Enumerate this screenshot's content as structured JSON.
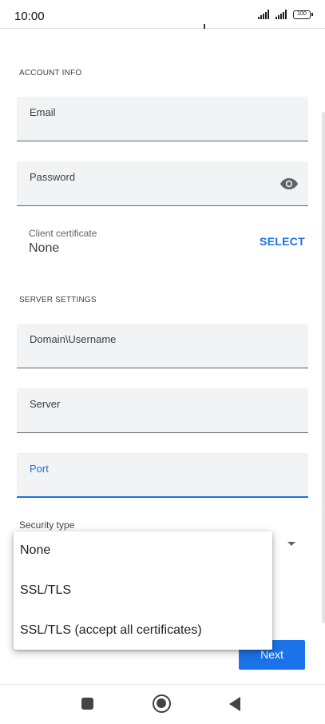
{
  "status_bar": {
    "time": "10:00",
    "battery": "100"
  },
  "account_info": {
    "section_label": "ACCOUNT INFO",
    "email_label": "Email",
    "password_label": "Password",
    "password_icon": "eye-icon",
    "client_certificate_label": "Client certificate",
    "client_certificate_value": "None",
    "select_label": "SELECT"
  },
  "server_settings": {
    "section_label": "SERVER SETTINGS",
    "domain_username_label": "Domain\\Username",
    "server_label": "Server",
    "port_label": "Port",
    "security_type_label": "Security type"
  },
  "security_type_options": [
    "None",
    "SSL/TLS",
    "SSL/TLS (accept all certificates)"
  ],
  "next_label": "Next",
  "colors": {
    "accent": "#1a73e8",
    "field_bg": "#f1f3f4"
  },
  "nav_icons": [
    "recents-icon",
    "home-icon",
    "back-icon"
  ]
}
